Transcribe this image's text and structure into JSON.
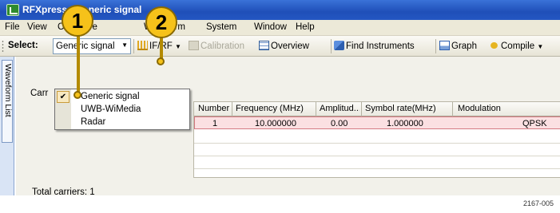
{
  "window": {
    "title": "RFXpress - Generic signal"
  },
  "menu": [
    "File",
    "View",
    "Configure",
    "Waveform",
    "System",
    "Window",
    "Help"
  ],
  "toolbar": {
    "select_label": "Select:",
    "signal_combo": "Generic signal",
    "ifrf": "IF/RF",
    "calibration": "Calibration",
    "overview": "Overview",
    "find_instruments": "Find Instruments",
    "graph": "Graph",
    "compile": "Compile"
  },
  "side_tab": {
    "label": "Waveform List"
  },
  "panel": {
    "carriers_label": "Carr",
    "total_carriers": "Total carriers:  1"
  },
  "dropdown": {
    "items": [
      {
        "label": "Generic signal",
        "checked": true
      },
      {
        "label": "UWB-WiMedia",
        "checked": false
      },
      {
        "label": "Radar",
        "checked": false
      }
    ]
  },
  "table": {
    "columns": [
      "Number",
      "Frequency (MHz)",
      "Amplitud...",
      "Symbol rate(MHz)",
      "Modulation"
    ],
    "rows": [
      {
        "number": "1",
        "frequency": "10.000000",
        "amplitude": "0.00",
        "symbol_rate": "1.000000",
        "modulation": "QPSK"
      }
    ]
  },
  "callouts": {
    "c1": "1",
    "c2": "2"
  },
  "figure_id": "2167-005",
  "colors": {
    "callout": "#f6c21a",
    "title_bar": "#2457c2",
    "selected_row": "#fbe0e2"
  }
}
